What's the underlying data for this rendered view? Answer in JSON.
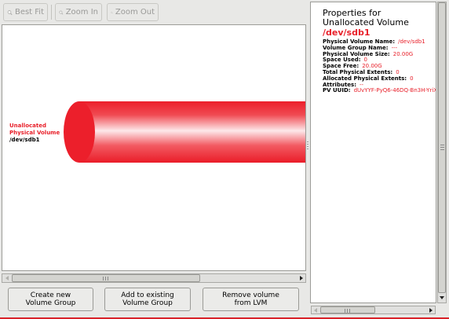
{
  "toolbar": {
    "best_fit_label": "Best Fit",
    "zoom_in_label": "Zoom In",
    "zoom_out_label": "Zoom Out",
    "icon": "magnifier-icon"
  },
  "canvas": {
    "label_line1": "Unallocated",
    "label_line2": "Physical Volume",
    "device": "/dev/sdb1",
    "colors": {
      "volume": "#ec1f2b",
      "label": "#e8202a"
    }
  },
  "buttons": {
    "create": "Create new\nVolume Group",
    "add": "Add to existing\nVolume Group",
    "remove": "Remove volume\nfrom LVM"
  },
  "properties": {
    "title": "Properties for\nUnallocated Volume",
    "device": "/dev/sdb1",
    "rows": [
      {
        "key": "Physical Volume Name:",
        "value": "/dev/sdb1"
      },
      {
        "key": "Volume Group Name:",
        "value": "---"
      },
      {
        "key": "Physical Volume Size:",
        "value": "20.00G"
      },
      {
        "key": "Space Used:",
        "value": "0"
      },
      {
        "key": "Space Free:",
        "value": "20.00G"
      },
      {
        "key": "Total Physical Extents:",
        "value": "0"
      },
      {
        "key": "Allocated Physical Extents:",
        "value": "0"
      },
      {
        "key": "Attributes:",
        "value": "--"
      },
      {
        "key": "PV UUID:",
        "value": "dUvYYF-PyQ6-46DQ-Bn3H-YriX-0"
      }
    ]
  }
}
